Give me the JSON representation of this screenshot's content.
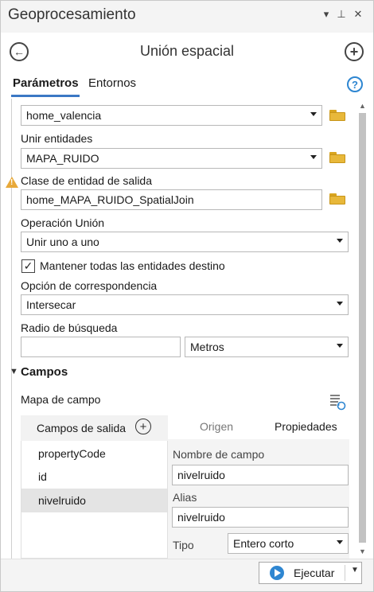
{
  "window": {
    "title": "Geoprocesamiento",
    "menu_icon": "chevron-down-icon",
    "pin_icon": "pin-icon",
    "close_icon": "close-icon"
  },
  "tool": {
    "title": "Unión espacial",
    "back_icon": "back-arrow-icon",
    "add_icon": "plus-circle-icon"
  },
  "tabs": [
    {
      "label": "Parámetros",
      "active": true
    },
    {
      "label": "Entornos",
      "active": false
    }
  ],
  "params": {
    "target_features": {
      "value": "home_valencia"
    },
    "join_features": {
      "label": "Unir entidades",
      "value": "MAPA_RUIDO"
    },
    "output": {
      "label": "Clase de entidad de salida",
      "value": "home_MAPA_RUIDO_SpatialJoin"
    },
    "join_operation": {
      "label": "Operación Unión",
      "value": "Unir uno a uno"
    },
    "keep_all": {
      "label": "Mantener todas las entidades destino",
      "checked": true
    },
    "match_option": {
      "label": "Opción de correspondencia",
      "value": "Intersecar"
    },
    "search_radius": {
      "label": "Radio de búsqueda",
      "value": "",
      "unit": "Metros"
    }
  },
  "fields_section": {
    "title": "Campos",
    "field_map_label": "Mapa de campo",
    "output_fields_header": "Campos de salida",
    "fields": [
      "propertyCode",
      "id",
      "nivelruido"
    ],
    "selected_field": "nivelruido",
    "tabs": [
      "Origen",
      "Propiedades"
    ],
    "active_tab": "Propiedades",
    "props": {
      "name_label": "Nombre de campo",
      "name_value": "nivelruido",
      "alias_label": "Alias",
      "alias_value": "nivelruido",
      "type_label": "Tipo",
      "type_value": "Entero corto"
    }
  },
  "footer": {
    "run_label": "Ejecutar"
  },
  "colors": {
    "accent": "#3b78c4",
    "run_icon": "#2e86d1",
    "warning": "#e8a93a",
    "folder": "#e8b83a"
  }
}
